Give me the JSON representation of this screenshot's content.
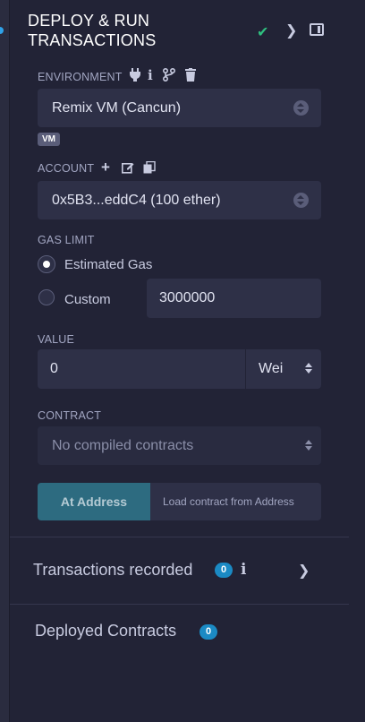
{
  "header": {
    "title_line1": "DEPLOY & RUN",
    "title_line2": "TRANSACTIONS",
    "status_icon": "check-icon",
    "expand_icon": "chevron-right-icon",
    "panel_icon": "panel-toggle-icon"
  },
  "environment": {
    "label": "ENVIRONMENT",
    "selected": "Remix VM (Cancun)",
    "badge": "VM",
    "icons": [
      "plug-icon",
      "info-icon",
      "fork-icon",
      "trash-icon"
    ]
  },
  "account": {
    "label": "ACCOUNT",
    "selected": "0x5B3...eddC4 (100 ether)",
    "icons": [
      "plus-icon",
      "edit-icon",
      "copy-icon"
    ]
  },
  "gas_limit": {
    "label": "GAS LIMIT",
    "option_estimated": "Estimated Gas",
    "option_custom": "Custom",
    "custom_value": "3000000",
    "selected": "Estimated Gas"
  },
  "value": {
    "label": "VALUE",
    "amount": "0",
    "unit": "Wei"
  },
  "contract": {
    "label": "CONTRACT",
    "placeholder": "No compiled contracts"
  },
  "at_address": {
    "button_label": "At Address",
    "input_placeholder": "Load contract from Address"
  },
  "transactions_recorded": {
    "title": "Transactions recorded",
    "count": "0"
  },
  "deployed_contracts": {
    "title": "Deployed Contracts",
    "count": "0"
  },
  "colors": {
    "background": "#222336",
    "input": "#2e3047",
    "accent": "#1b8ac4",
    "success": "#2fbf7f",
    "button": "#2d6b80"
  }
}
